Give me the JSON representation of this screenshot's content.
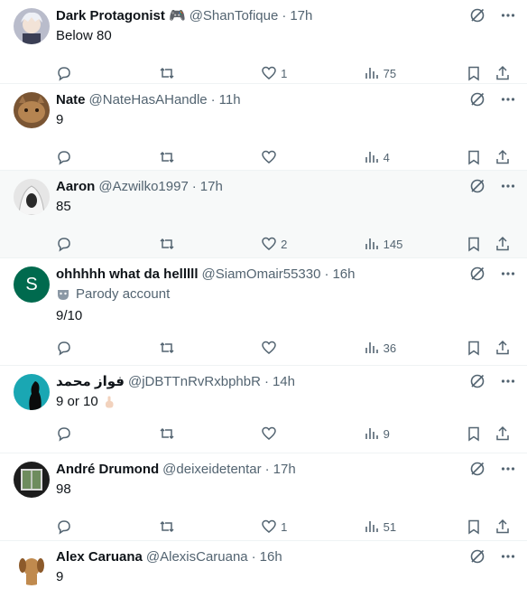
{
  "replies": [
    {
      "name": "Dark Protagonist 🎮",
      "handle": "@ShanTofique",
      "time": "17h",
      "text": "Below 80",
      "replies": "",
      "retweets": "",
      "likes": "1",
      "views": "75",
      "avatar_color": "#c7c9d6"
    },
    {
      "name": "Nate",
      "handle": "@NateHasAHandle",
      "time": "11h",
      "text": "9",
      "replies": "",
      "retweets": "",
      "likes": "",
      "views": "4",
      "avatar_color": "#a0744a"
    },
    {
      "name": "Aaron",
      "handle": "@Azwilko1997",
      "time": "17h",
      "text": "85",
      "replies": "",
      "retweets": "",
      "likes": "2",
      "views": "145",
      "avatar_color": "#d8d8d8"
    },
    {
      "name": "ohhhhh what da helllll",
      "handle": "@SiamOmair55330",
      "time": "16h",
      "parody_label": "Parody account",
      "text": "9/10",
      "replies": "",
      "retweets": "",
      "likes": "",
      "views": "36",
      "avatar_letter": "S",
      "avatar_color": "#006a4e"
    },
    {
      "name": "فواز محمد",
      "handle": "@jDBTTnRvRxbphbR",
      "time": "14h",
      "text": "9 or 10",
      "replies": "",
      "retweets": "",
      "likes": "",
      "views": "9",
      "avatar_color": "#1aa7b3"
    },
    {
      "name": "André Drumond",
      "handle": "@deixeidetentar",
      "time": "17h",
      "text": "98",
      "replies": "",
      "retweets": "",
      "likes": "1",
      "views": "51",
      "avatar_color": "#3c4f3a"
    },
    {
      "name": "Alex Caruana",
      "handle": "@AlexisCaruana",
      "time": "16h",
      "text": "9",
      "avatar_color": "#c08a4e"
    }
  ]
}
